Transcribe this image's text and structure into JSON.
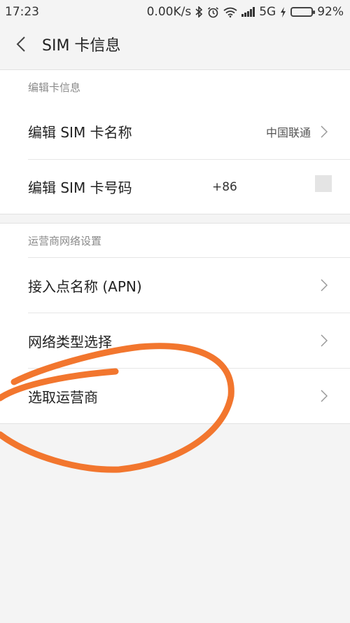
{
  "status_bar": {
    "time": "17:23",
    "speed": "0.00K/s",
    "network": "5G",
    "battery": "92%",
    "battery_level": 0.92,
    "icons": [
      "bluetooth-icon",
      "alarm-icon",
      "wifi-icon",
      "signal-icon",
      "charging-icon",
      "battery-icon"
    ]
  },
  "header": {
    "title": "SIM 卡信息",
    "back_icon": "chevron-left-icon"
  },
  "sections": [
    {
      "header": "编辑卡信息",
      "items": [
        {
          "label": "编辑 SIM 卡名称",
          "value": "中国联通"
        },
        {
          "label": "编辑 SIM 卡号码",
          "value": "+86"
        }
      ]
    },
    {
      "header": "运营商网络设置",
      "items": [
        {
          "label": "接入点名称 (APN)"
        },
        {
          "label": "网络类型选择"
        },
        {
          "label": "选取运营商"
        }
      ]
    }
  ],
  "colors": {
    "background": "#f4f4f4",
    "card": "#ffffff",
    "annotation": "#f2762e",
    "battery_fill": "#3fc244"
  }
}
